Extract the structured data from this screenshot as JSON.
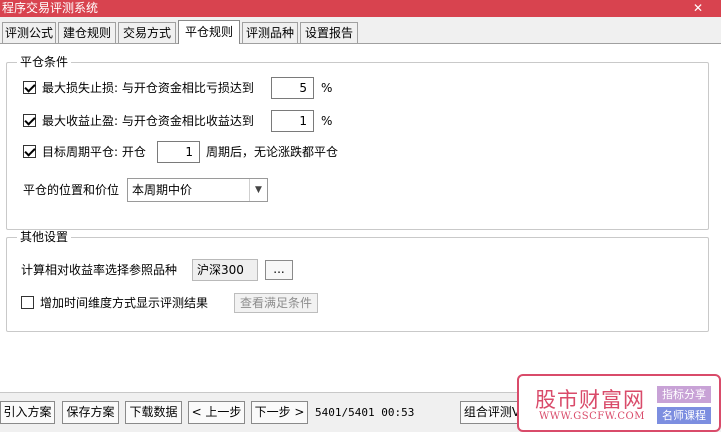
{
  "window": {
    "title": "程序交易评测系统",
    "close_glyph": "✕"
  },
  "tabs": [
    {
      "label": "评测公式"
    },
    {
      "label": "建仓规则"
    },
    {
      "label": "交易方式"
    },
    {
      "label": "平仓规则",
      "active": true
    },
    {
      "label": "评测品种"
    },
    {
      "label": "设置报告"
    }
  ],
  "close_conditions": {
    "title": "平仓条件",
    "max_loss": {
      "label": "最大损失止损: 与开仓资金相比亏损达到",
      "value": "5",
      "unit": "%",
      "checked": true
    },
    "max_profit": {
      "label": "最大收益止盈: 与开仓资金相比收益达到",
      "value": "1",
      "unit": "%",
      "checked": true
    },
    "target_period": {
      "label": "目标周期平仓: 开仓",
      "value": "1",
      "suffix": "周期后，无论涨跌都平仓",
      "checked": true
    },
    "position_price": {
      "label": "平仓的位置和价位",
      "selected": "本周期中价"
    }
  },
  "other_settings": {
    "title": "其他设置",
    "reference": {
      "label": "计算相对收益率选择参照品种",
      "value": "沪深300",
      "browse_label": "..."
    },
    "time_dimension": {
      "label": "增加时间维度方式显示评测结果",
      "checked": false,
      "button_label": "查看满足条件"
    }
  },
  "bottom_bar": {
    "import_label": "引入方案",
    "save_label": "保存方案",
    "download_label": "下载数据",
    "prev_label": "< 上一步",
    "next_label": "下一步 >",
    "status": "5401/5401 00:53",
    "combo_label": "组合评测V"
  },
  "watermark": {
    "main": "股市财富网",
    "url": "WWW.GSCFW.COM",
    "tag1": "指标分享",
    "tag2": "名师课程",
    "colors": {
      "brand": "#d94b6a",
      "tag1": "#c8a2d6",
      "tag2": "#7c8ee0"
    }
  },
  "colors": {
    "titlebar": "#d8434f",
    "panel": "#ffffff",
    "chrome": "#f0f0f0"
  }
}
